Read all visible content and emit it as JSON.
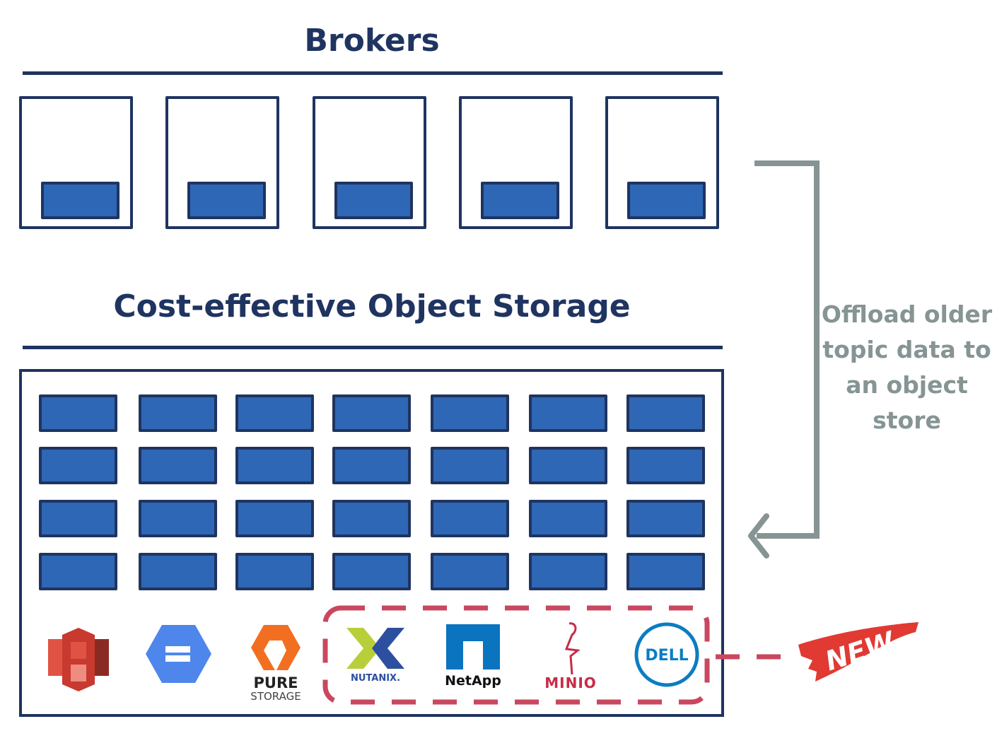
{
  "diagram": {
    "brokers_title": "Brokers",
    "storage_title": "Cost-effective Object Storage",
    "broker_count": 5,
    "partitions_per_broker": 1,
    "storage_grid": {
      "rows": 4,
      "columns": 7
    },
    "offload_label": "Offload older topic data to an object store",
    "new_badge": "NEW",
    "colors": {
      "navy": "#1f3460",
      "partition_blue": "#2e67b5",
      "arrow_gray": "#869494",
      "dashed_red": "#c9475f",
      "badge_red": "#e03a32"
    },
    "providers": [
      {
        "name": "Amazon S3",
        "icon": "aws-s3-icon",
        "is_new": false
      },
      {
        "name": "Google Cloud Storage",
        "icon": "gcs-icon",
        "is_new": false
      },
      {
        "name": "Pure Storage",
        "icon": "pure-storage-icon",
        "label_top": "PURE",
        "label_bottom": "STORAGE",
        "is_new": false
      },
      {
        "name": "Nutanix",
        "icon": "nutanix-icon",
        "label": "NUTANIX.",
        "is_new": true
      },
      {
        "name": "NetApp",
        "icon": "netapp-icon",
        "label": "NetApp",
        "is_new": true
      },
      {
        "name": "MinIO",
        "icon": "minio-icon",
        "label": "MINIO",
        "is_new": true
      },
      {
        "name": "Dell",
        "icon": "dell-icon",
        "label": "DELL",
        "is_new": true
      }
    ]
  }
}
